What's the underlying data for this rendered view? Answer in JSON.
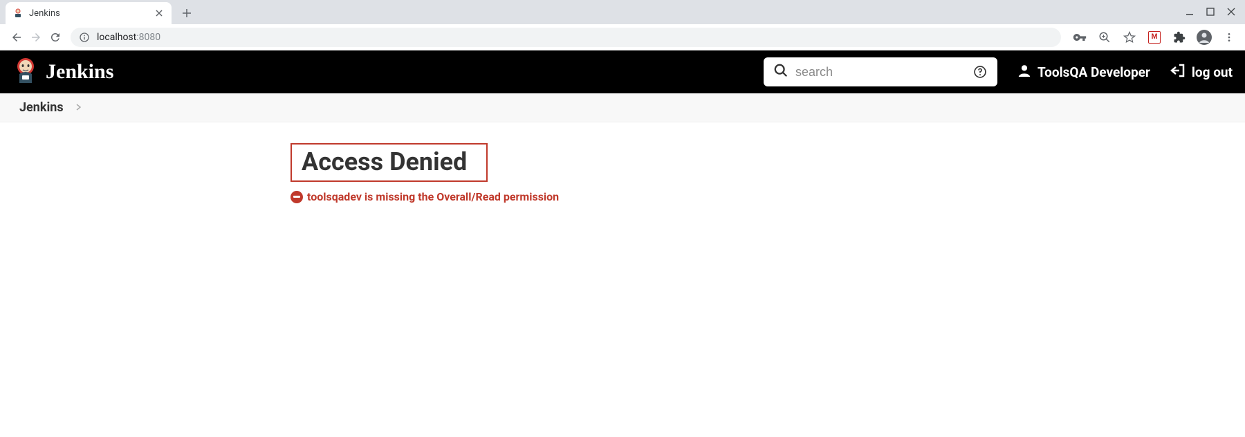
{
  "browser": {
    "tab_title": "Jenkins",
    "address": {
      "host": "localhost",
      "port": ":8080"
    }
  },
  "header": {
    "logo_text": "Jenkins",
    "search_placeholder": "search",
    "user_name": "ToolsQA Developer",
    "logout_label": "log out"
  },
  "breadcrumb": {
    "items": [
      "Jenkins"
    ]
  },
  "main": {
    "heading": "Access Denied",
    "error_message": "toolsqadev is missing the Overall/Read permission"
  }
}
